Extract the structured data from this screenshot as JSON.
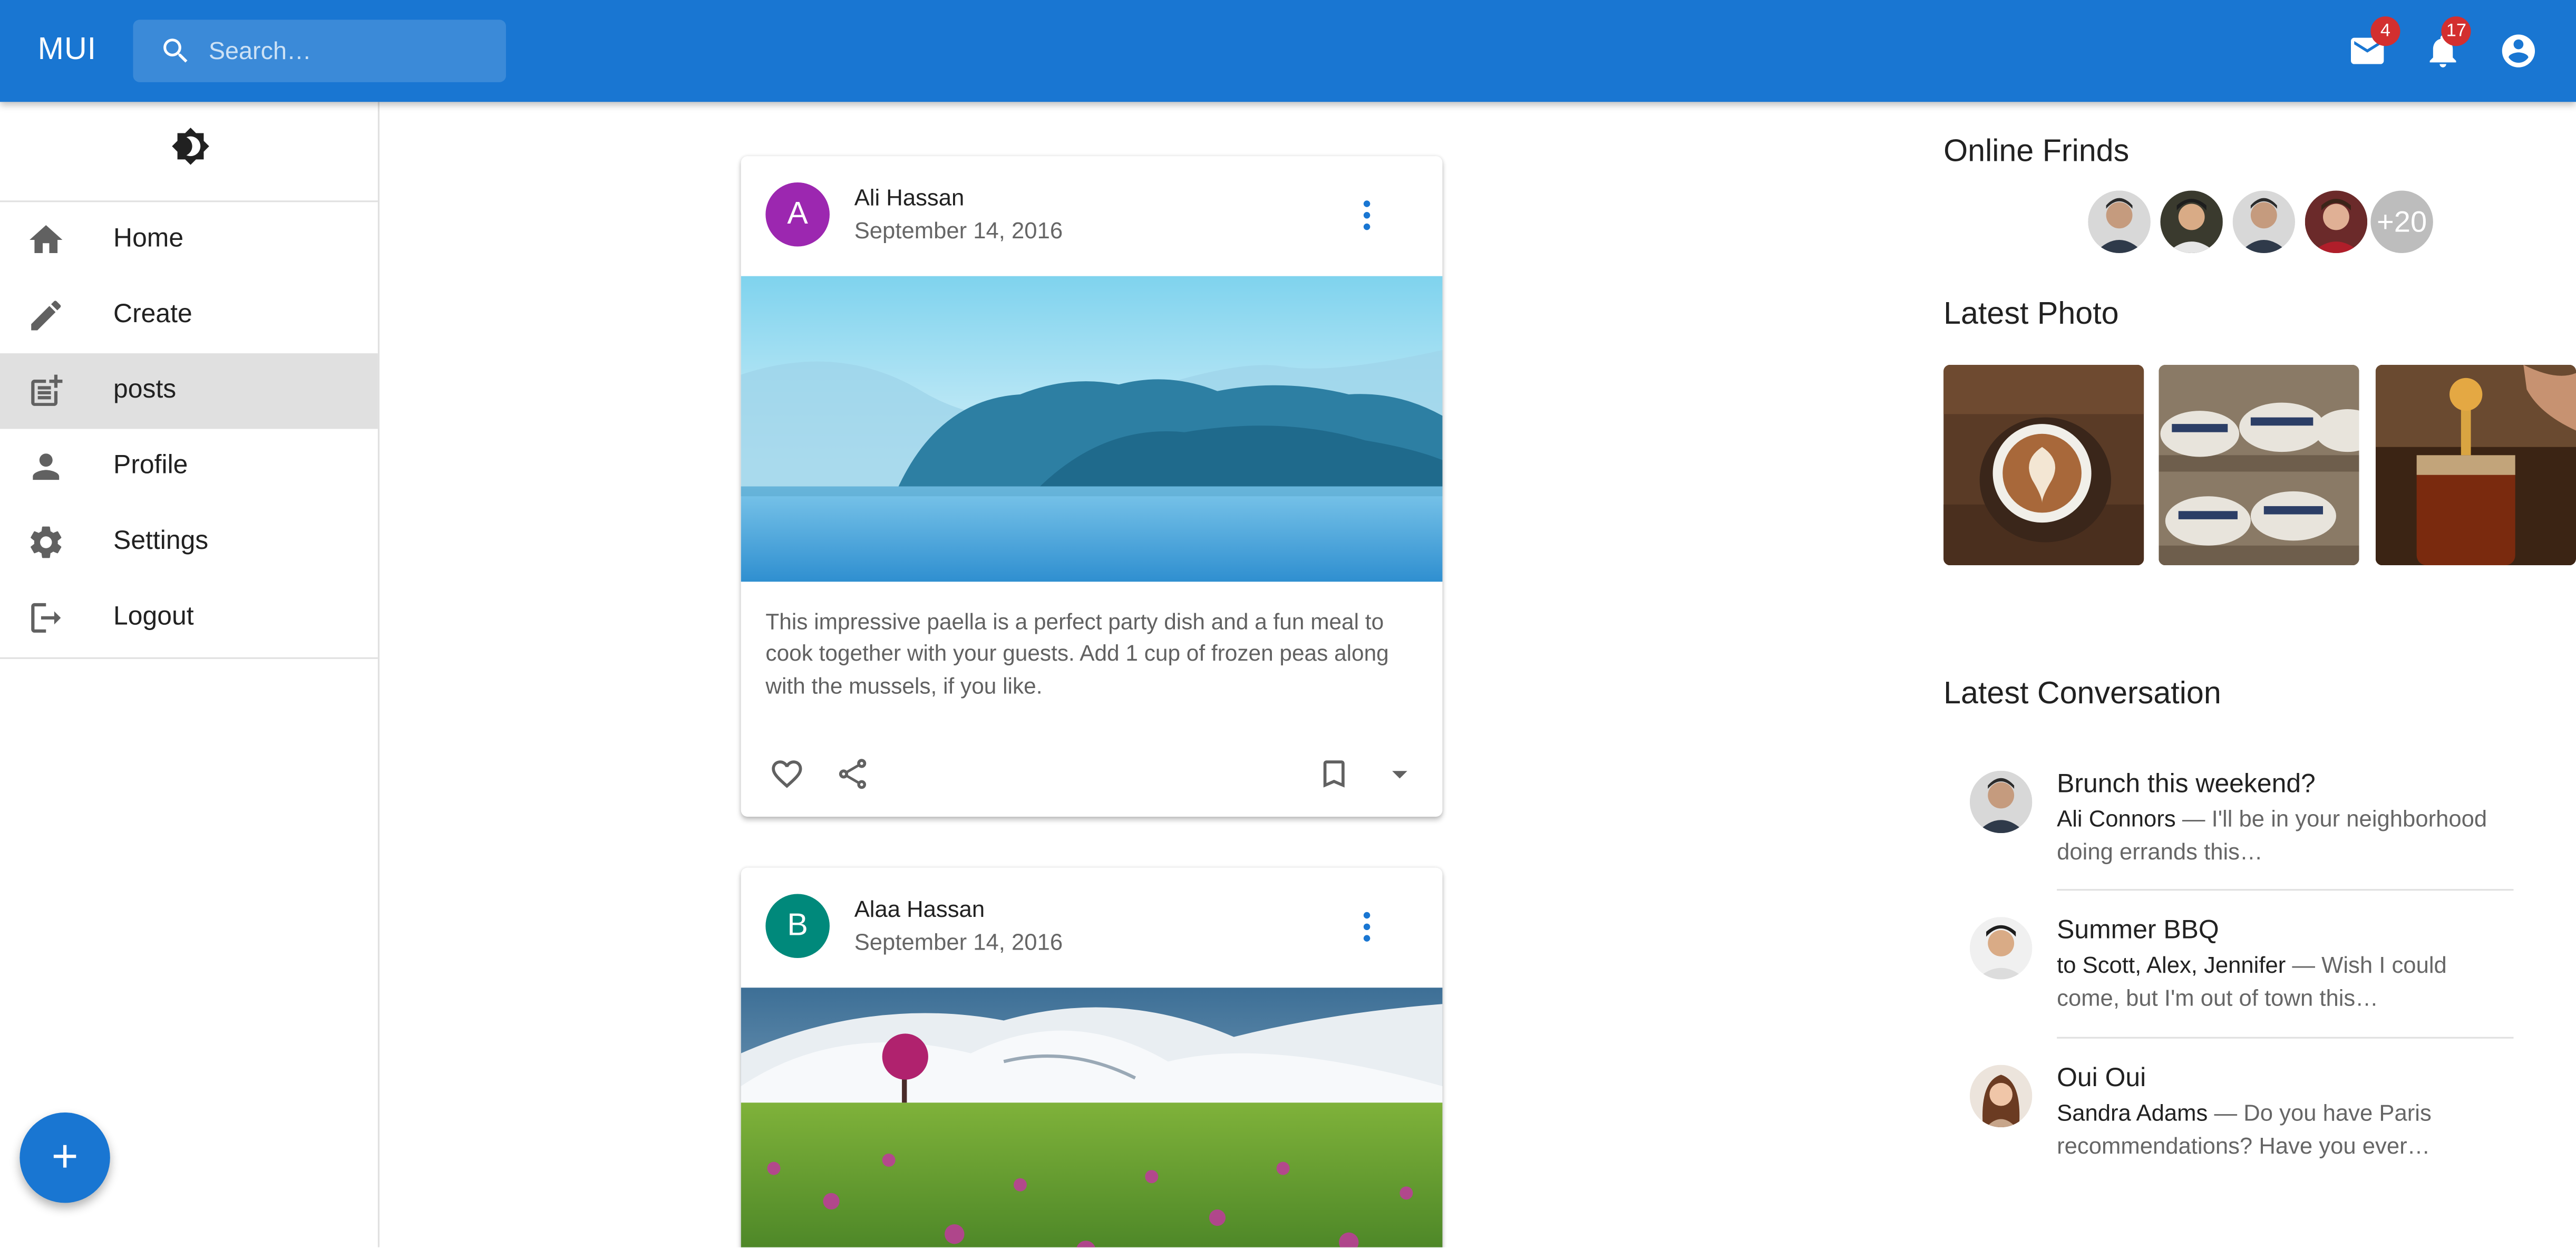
{
  "appbar": {
    "brand": "MUI",
    "search_placeholder": "Search…",
    "mail_badge": "4",
    "notifications_badge": "17",
    "primary_color": "#1976d2"
  },
  "sidebar": {
    "items": [
      {
        "label": "Home",
        "icon": "home-icon"
      },
      {
        "label": "Create",
        "icon": "pencil-icon"
      },
      {
        "label": "posts",
        "icon": "post-add-icon",
        "active": true
      },
      {
        "label": "Profile",
        "icon": "person-icon"
      },
      {
        "label": "Settings",
        "icon": "gear-icon"
      },
      {
        "label": "Logout",
        "icon": "logout-icon"
      }
    ],
    "fab_label": "+"
  },
  "posts": [
    {
      "avatar_letter": "A",
      "avatar_color": "#9c27b0",
      "author": "Ali Hassan",
      "date": "September 14, 2016",
      "text": "This impressive paella is a perfect party dish and a fun meal to cook together with your guests. Add 1 cup of frozen peas along with the mussels, if you like."
    },
    {
      "avatar_letter": "B",
      "avatar_color": "#00897b",
      "author": "Alaa Hassan",
      "date": "September 14, 2016"
    }
  ],
  "right": {
    "online_title": "Online Frinds",
    "online_extra": "+20",
    "photos_title": "Latest Photo",
    "conversation_title": "Latest Conversation",
    "conversations": [
      {
        "title": "Brunch this weekend?",
        "from": "Ali Connors",
        "snippet": " — I'll be in your neighborhood doing errands this…"
      },
      {
        "title": "Summer BBQ",
        "from": "to Scott, Alex, Jennifer",
        "snippet": " — Wish I could come, but I'm out of town this…"
      },
      {
        "title": "Oui Oui",
        "from": "Sandra Adams",
        "snippet": " — Do you have Paris recommendations? Have you ever…"
      }
    ]
  }
}
